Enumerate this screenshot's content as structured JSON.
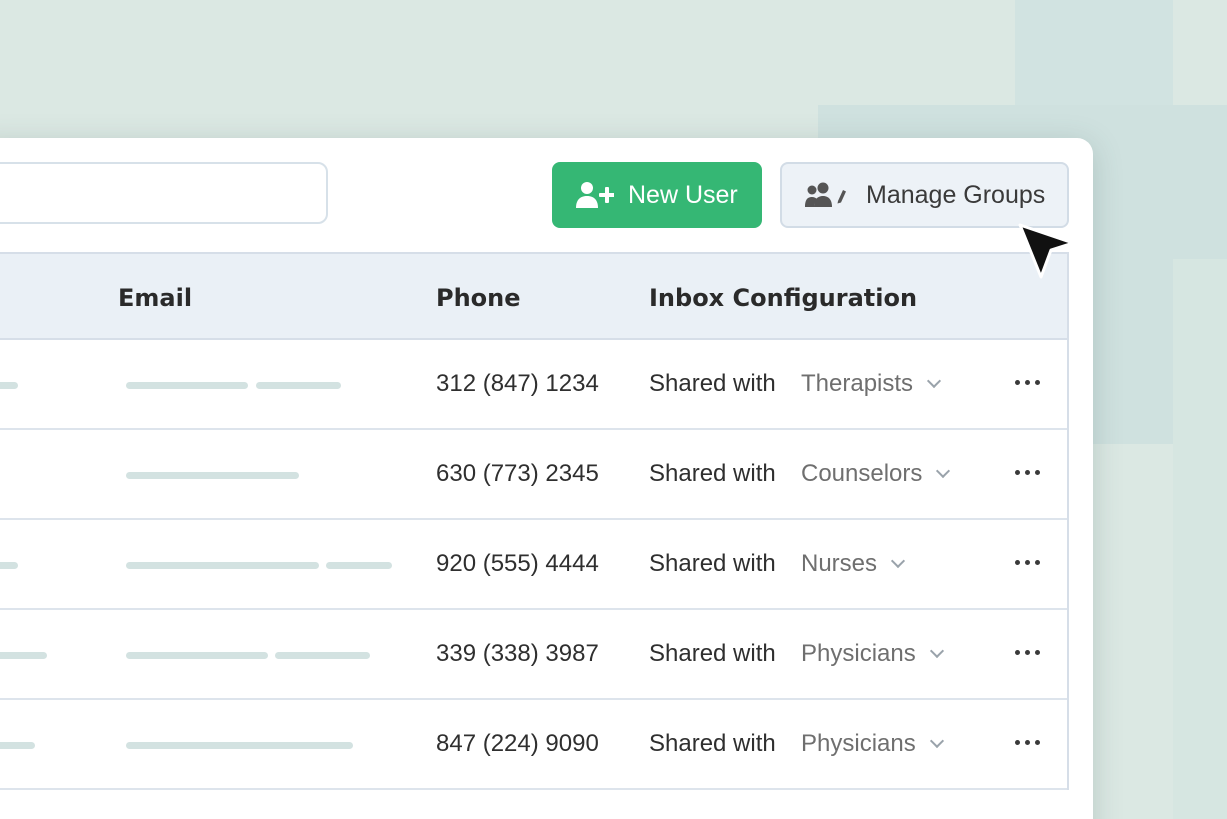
{
  "toolbar": {
    "search_placeholder": "",
    "new_user_label": "New User",
    "manage_groups_label": "Manage Groups"
  },
  "table": {
    "headers": {
      "email": "Email",
      "phone": "Phone",
      "inbox": "Inbox Configuration"
    },
    "rows": [
      {
        "phone": "312 (847) 1234",
        "shared": "Shared with",
        "group": "Therapists"
      },
      {
        "phone": "630 (773) 2345",
        "shared": "Shared with",
        "group": "Counselors"
      },
      {
        "phone": "920 (555) 4444",
        "shared": "Shared with",
        "group": "Nurses"
      },
      {
        "phone": "339 (338) 3987",
        "shared": "Shared with",
        "group": "Physicians"
      },
      {
        "phone": "847 (224) 9090",
        "shared": "Shared with",
        "group": "Physicians"
      }
    ]
  },
  "colors": {
    "accent_green": "#35b774",
    "header_bg": "#eaf0f6",
    "placeholder_bar": "#d3e2e1"
  },
  "icons": {
    "new_user": "user-plus-icon",
    "manage_groups": "users-edit-icon",
    "row_menu": "more-horizontal-icon",
    "dropdown": "chevron-down-icon",
    "pointer": "mouse-cursor-icon"
  }
}
